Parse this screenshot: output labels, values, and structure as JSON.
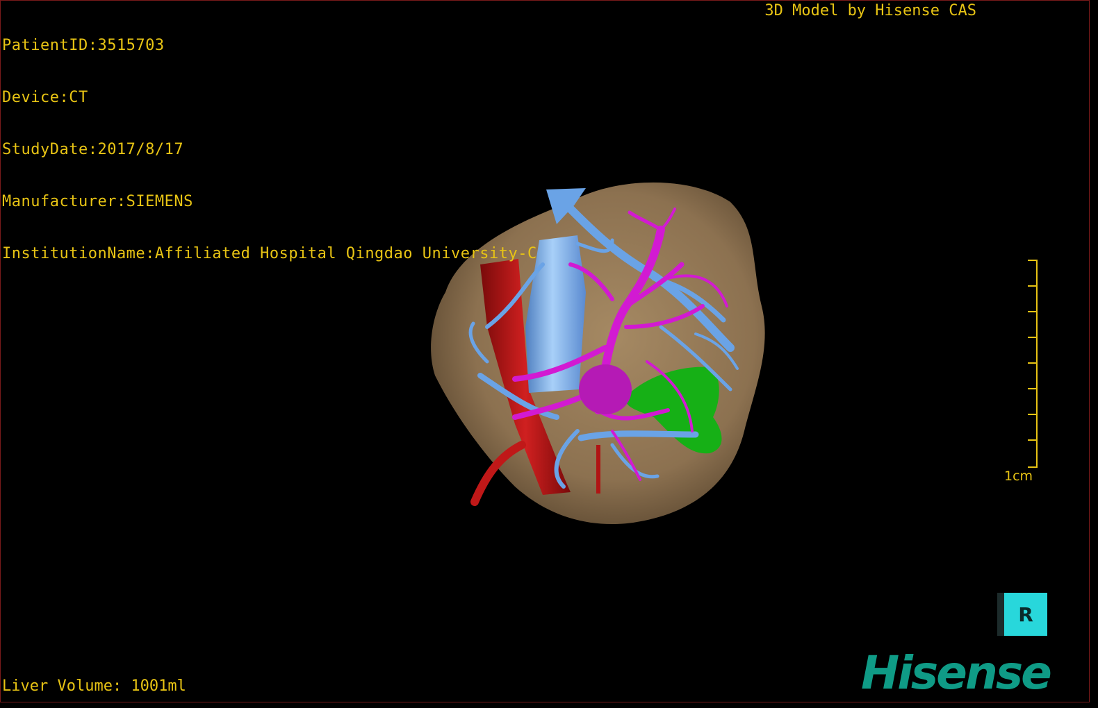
{
  "header": {
    "patient_id": "PatientID:3515703",
    "device": "Device:CT",
    "study_date": "StudyDate:2017/8/17",
    "manufacturer": "Manufacturer:SIEMENS",
    "institution": "InstitutionName:Affiliated Hospital Qingdao University-C",
    "model_credit": "3D Model by Hisense CAS"
  },
  "footer": {
    "liver_volume": "Liver Volume: 1001ml",
    "brand_logo": "Hisense"
  },
  "scale_bar": {
    "label": "1cm"
  },
  "toolbar": {
    "tool_glyph": "R",
    "tool_icon": "rotate-tool-icon"
  },
  "colors": {
    "overlay_text": "#e8c414",
    "liver": "#8c7150",
    "hepatic_vein": "#d21ad2",
    "portal_vein": "#6aa3e6",
    "artery": "#b01414",
    "lesion": "#16b016",
    "tool_button": "#28d7db",
    "brand": "#0f9b86"
  }
}
